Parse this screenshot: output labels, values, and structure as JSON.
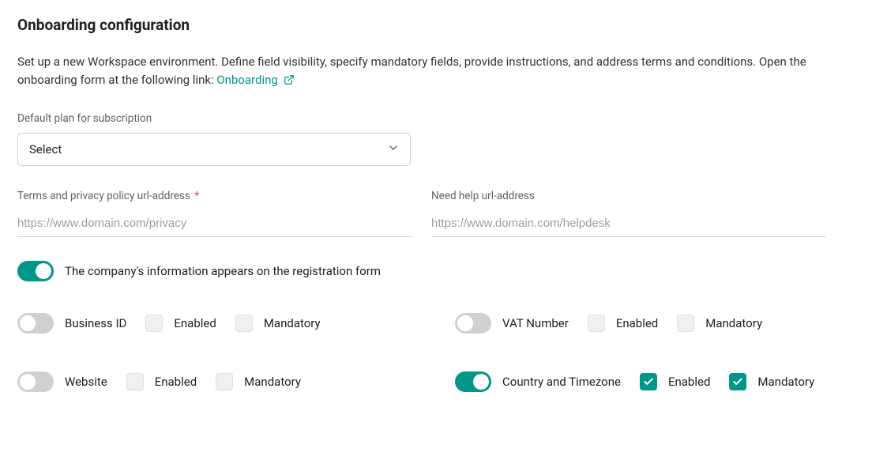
{
  "page": {
    "title": "Onboarding configuration",
    "intro_text": "Set up a new Workspace environment. Define field visibility, specify mandatory fields, provide instructions, and address terms and conditions. Open the onboarding form at the following link: ",
    "link_text": "Onboarding"
  },
  "plan_select": {
    "label": "Default plan for subscription",
    "value": "Select"
  },
  "terms_url": {
    "label": "Terms and privacy policy url-address",
    "placeholder": "https://www.domain.com/privacy",
    "value": ""
  },
  "help_url": {
    "label": "Need help url-address",
    "placeholder": "https://www.domain.com/helpdesk",
    "value": ""
  },
  "company_info_toggle": {
    "label": "The company's information appears on the registration form",
    "on": true
  },
  "labels": {
    "enabled": "Enabled",
    "mandatory": "Mandatory"
  },
  "fields": {
    "business_id": {
      "name": "Business ID",
      "toggle_on": false,
      "enabled": false,
      "mandatory": false
    },
    "vat_number": {
      "name": "VAT Number",
      "toggle_on": false,
      "enabled": false,
      "mandatory": false
    },
    "website": {
      "name": "Website",
      "toggle_on": false,
      "enabled": false,
      "mandatory": false
    },
    "country_timezone": {
      "name": "Country and Timezone",
      "toggle_on": true,
      "enabled": true,
      "mandatory": true
    }
  }
}
